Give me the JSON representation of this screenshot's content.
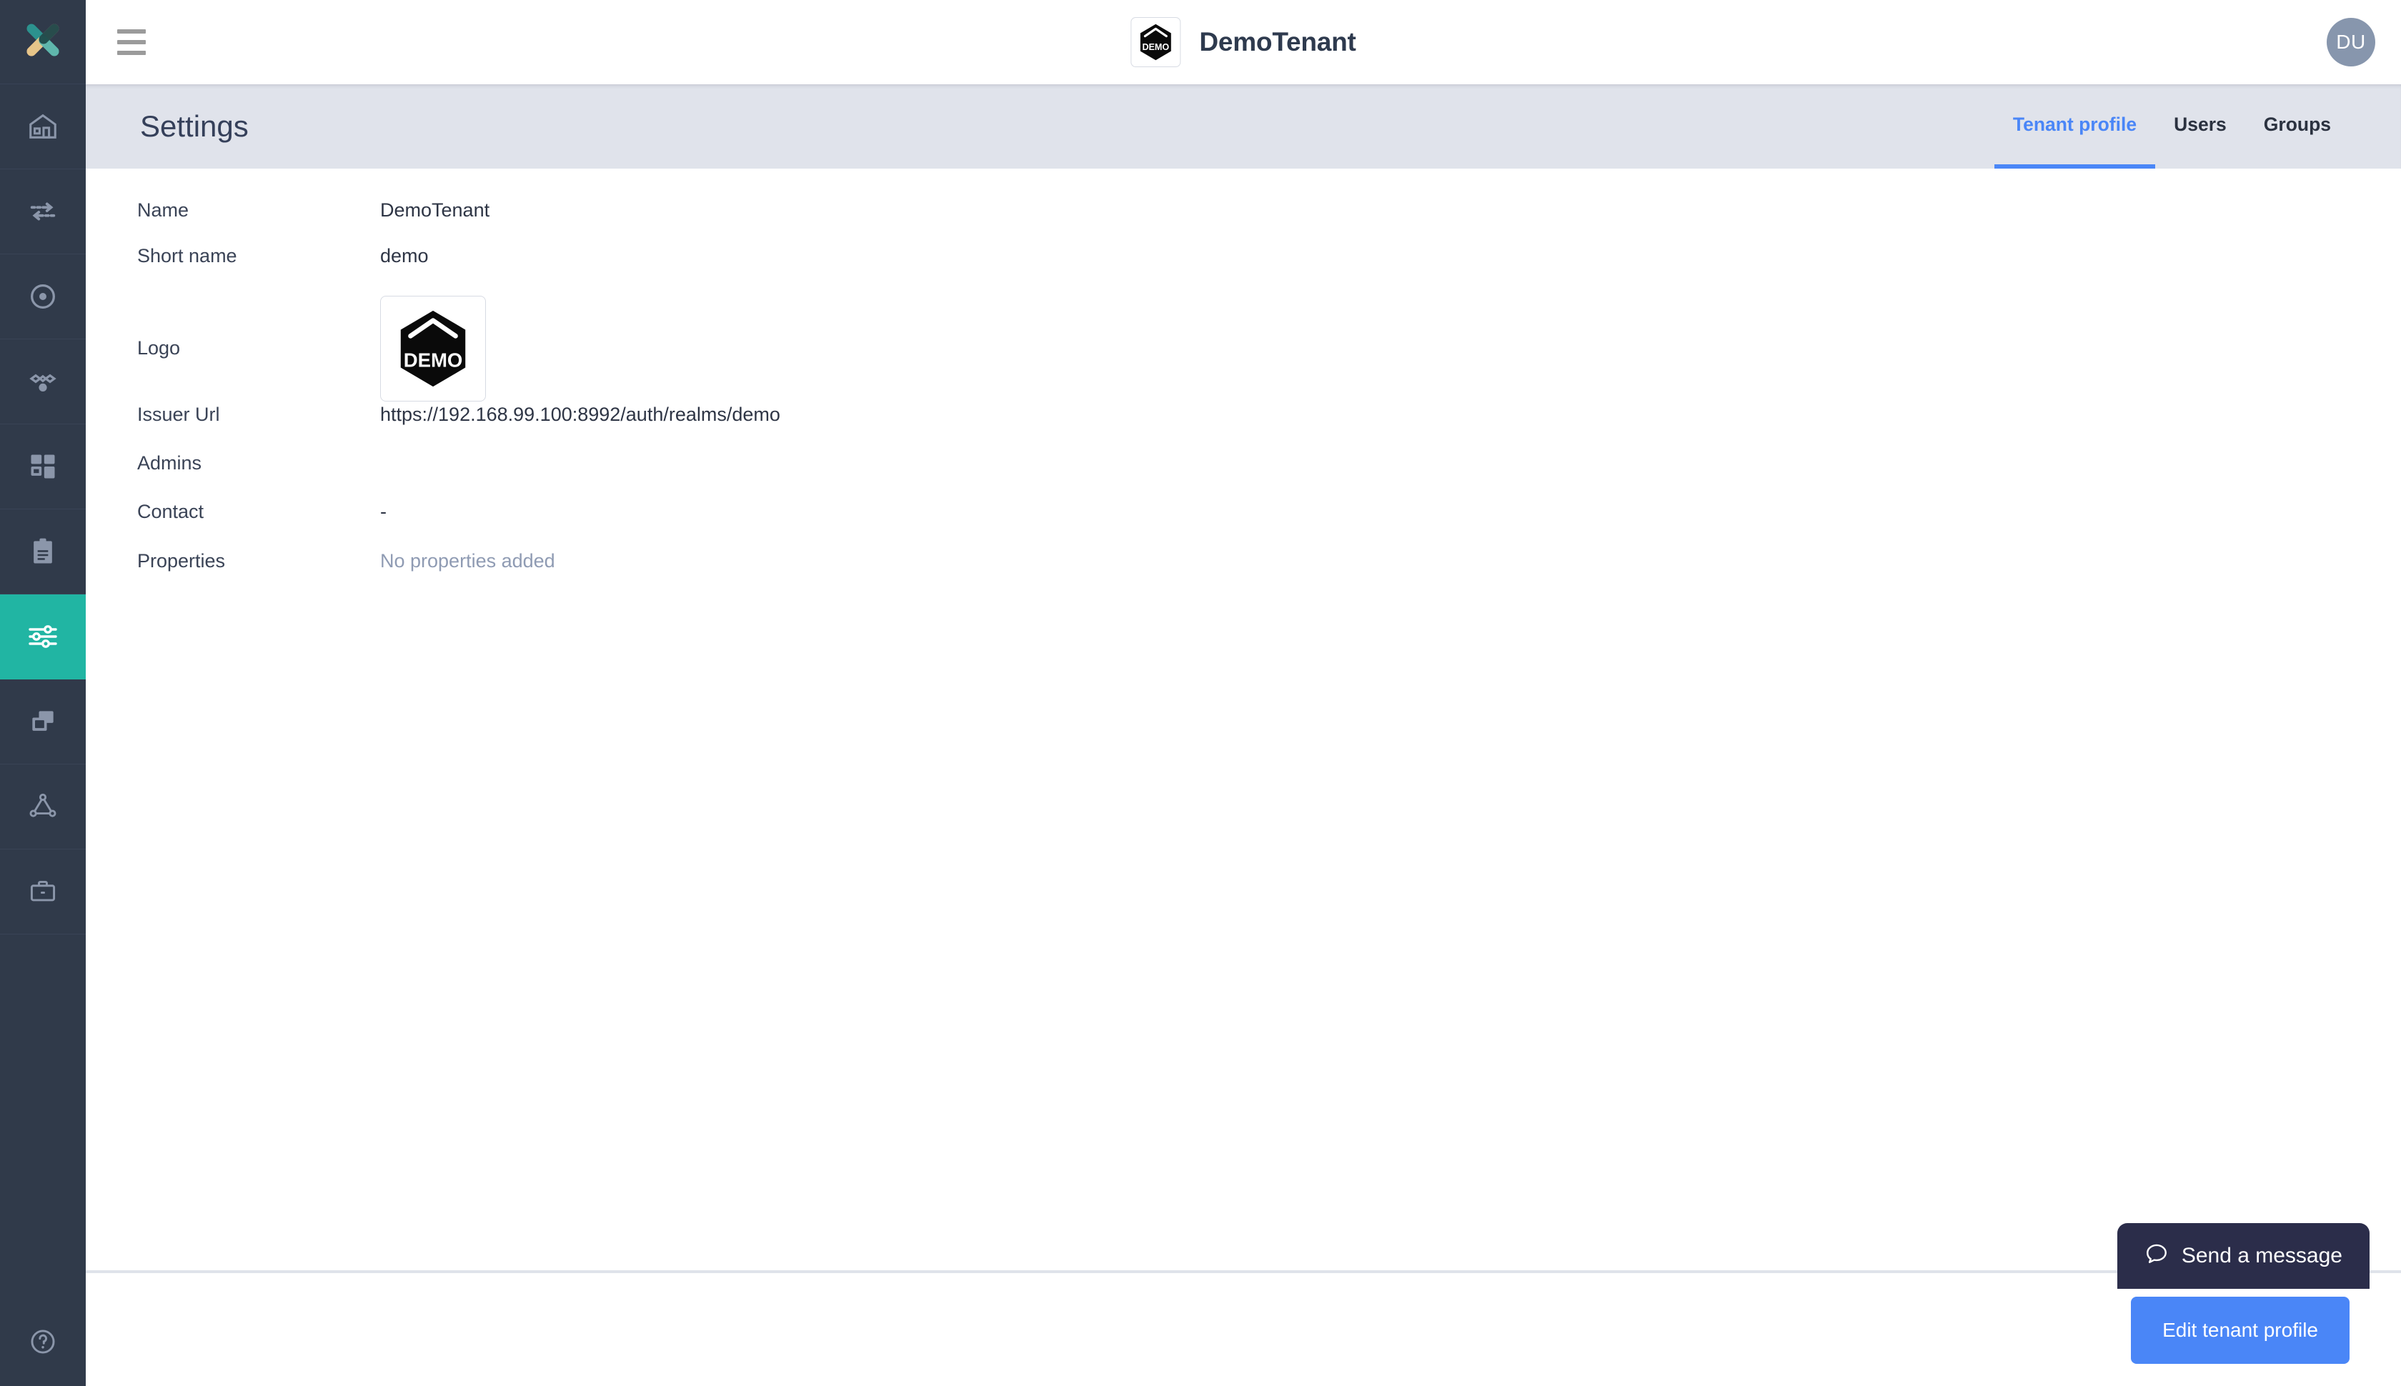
{
  "colors": {
    "sidebar_bg": "#303a4a",
    "sidebar_active": "#21b5a3",
    "pagebar_bg": "#e0e3eb",
    "accent_blue": "#4a86f7",
    "avatar_bg": "#8796ad",
    "chat_bg": "#2b2d4a",
    "muted_text": "#8f9bb3"
  },
  "sidebar": {
    "brand_icon": "x-logo-icon",
    "items": [
      {
        "icon": "home-icon",
        "name": "home",
        "active": false
      },
      {
        "icon": "transfer-arrows-icon",
        "name": "transfers",
        "active": false
      },
      {
        "icon": "target-circle-icon",
        "name": "target",
        "active": false
      },
      {
        "icon": "nodes-network-icon",
        "name": "network",
        "active": false
      },
      {
        "icon": "grid-squares-icon",
        "name": "apps",
        "active": false
      },
      {
        "icon": "clipboard-icon",
        "name": "clipboard",
        "active": false
      },
      {
        "icon": "sliders-icon",
        "name": "settings",
        "active": true
      },
      {
        "icon": "copy-windows-icon",
        "name": "duplicates",
        "active": false
      },
      {
        "icon": "triangle-graph-icon",
        "name": "graph",
        "active": false
      },
      {
        "icon": "briefcase-icon",
        "name": "briefcase",
        "active": false
      }
    ],
    "help_icon": "question-circle-icon"
  },
  "topbar": {
    "menu_icon": "hamburger-menu-icon",
    "tenant_logo_alt": "DEMO",
    "tenant_logo_text": "DEMO",
    "tenant_name": "DemoTenant",
    "avatar_initials": "DU"
  },
  "page": {
    "title": "Settings",
    "tabs": [
      {
        "label": "Tenant profile",
        "active": true
      },
      {
        "label": "Users",
        "active": false
      },
      {
        "label": "Groups",
        "active": false
      }
    ]
  },
  "profile": {
    "fields": [
      {
        "label": "Name",
        "value": "DemoTenant"
      },
      {
        "label": "Short name",
        "value": "demo"
      },
      {
        "label": "Logo",
        "value": ""
      },
      {
        "label": "Issuer Url",
        "value": "https://192.168.99.100:8992/auth/realms/demo"
      },
      {
        "label": "Admins",
        "value": ""
      },
      {
        "label": "Contact",
        "value": "-"
      },
      {
        "label": "Properties",
        "value": "No properties added"
      }
    ],
    "logo_text": "DEMO"
  },
  "footer": {
    "edit_button": "Edit tenant profile"
  },
  "chat": {
    "label": "Send a message",
    "icon": "chat-bubble-icon"
  }
}
